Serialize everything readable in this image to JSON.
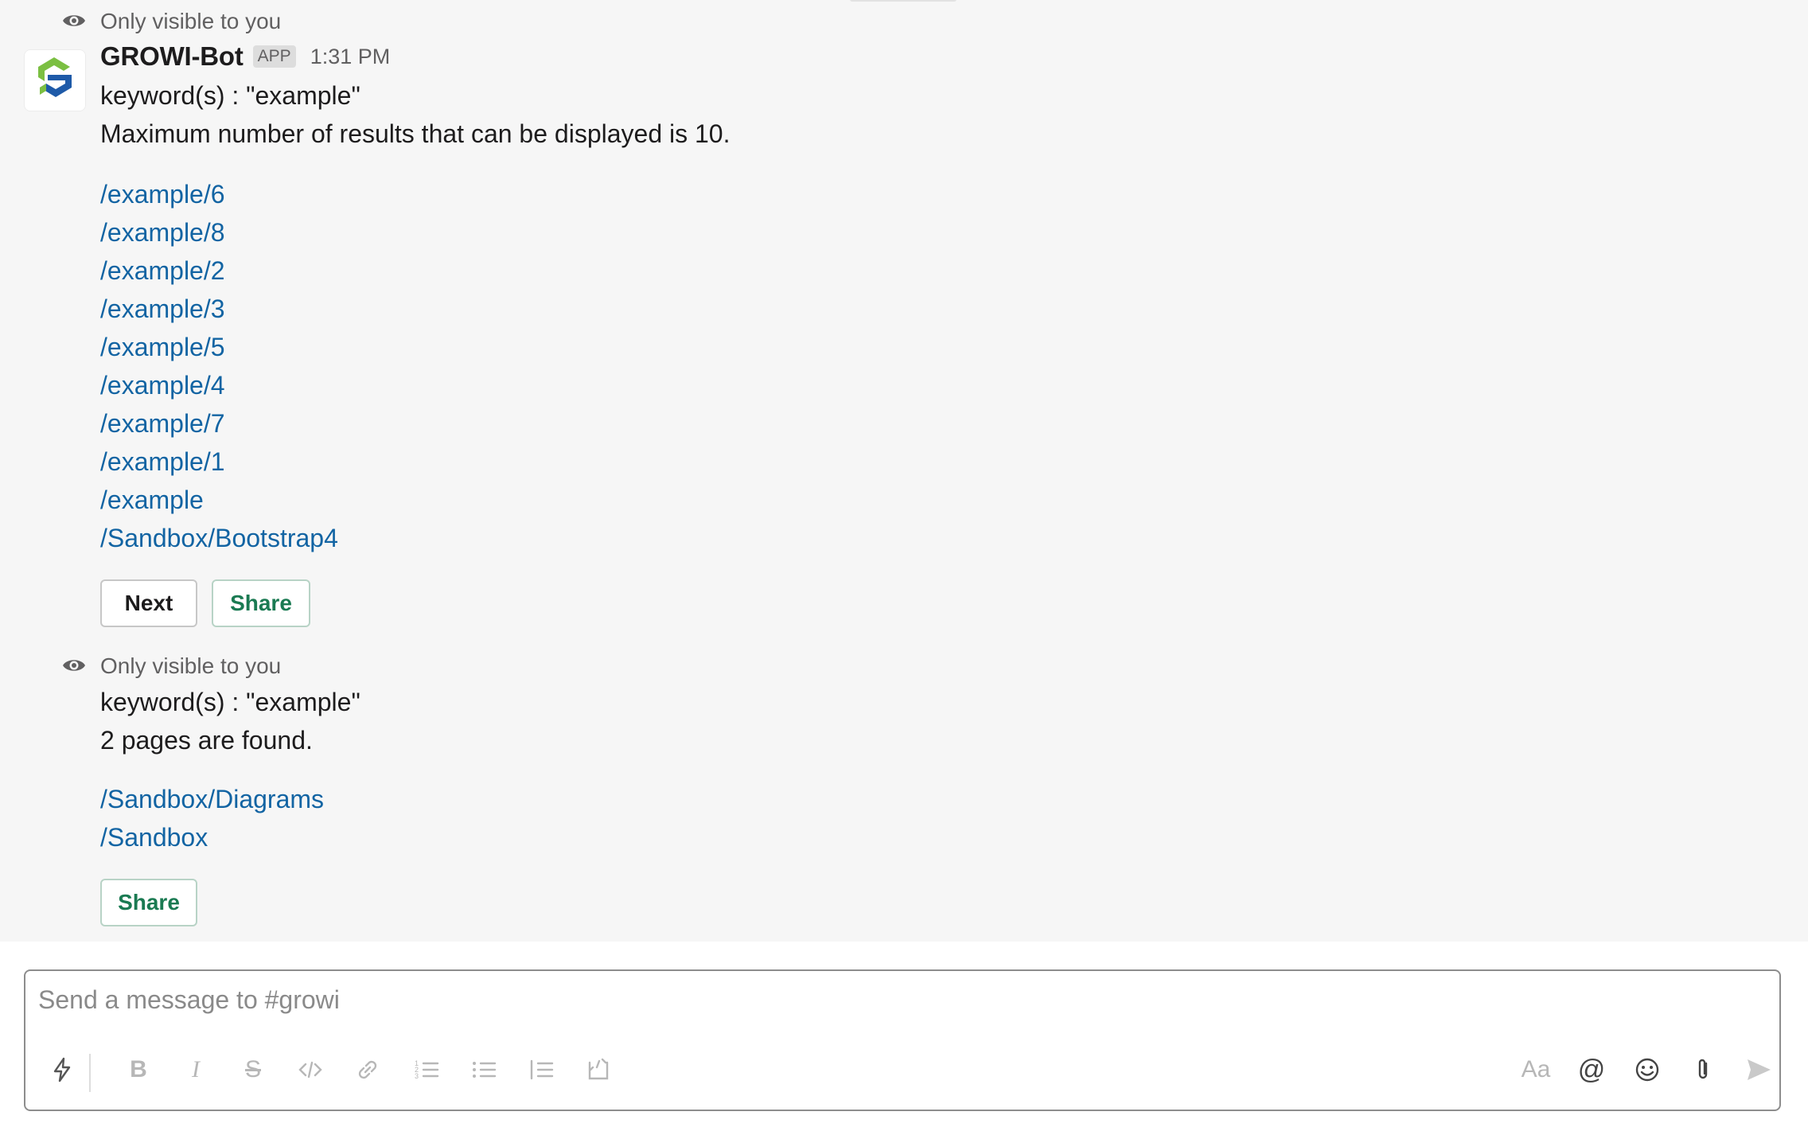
{
  "messages": {
    "ephemeral_note": "Only visible to you",
    "first": {
      "bot_name": "GROWI-Bot",
      "badge": "APP",
      "time": "1:31 PM",
      "keyword_line": "keyword(s) : \"example\"",
      "max_line": "Maximum number of results that can be displayed is 10.",
      "results": [
        "/example/6",
        "/example/8",
        "/example/2",
        "/example/3",
        "/example/5",
        "/example/4",
        "/example/7",
        "/example/1",
        "/example",
        "/Sandbox/Bootstrap4"
      ],
      "next_label": "Next",
      "share_label": "Share"
    },
    "second": {
      "keyword_line": "keyword(s) : \"example\"",
      "found_line": "2 pages are found.",
      "results": [
        "/Sandbox/Diagrams",
        "/Sandbox"
      ],
      "share_label": "Share"
    }
  },
  "composer": {
    "placeholder": "Send a message to #growi",
    "tools": [
      "shortcuts-icon",
      "bold-icon",
      "italic-icon",
      "strikethrough-icon",
      "code-icon",
      "link-icon",
      "ordered-list-icon",
      "bulleted-list-icon",
      "blockquote-icon",
      "code-block-icon",
      "formatting-icon",
      "mention-icon",
      "emoji-icon",
      "attach-icon",
      "send-icon"
    ]
  },
  "colors": {
    "link": "#1264a3",
    "share_green": "#1a7a52",
    "logo_green": "#7bbf42",
    "logo_blue": "#1e5aa8"
  }
}
